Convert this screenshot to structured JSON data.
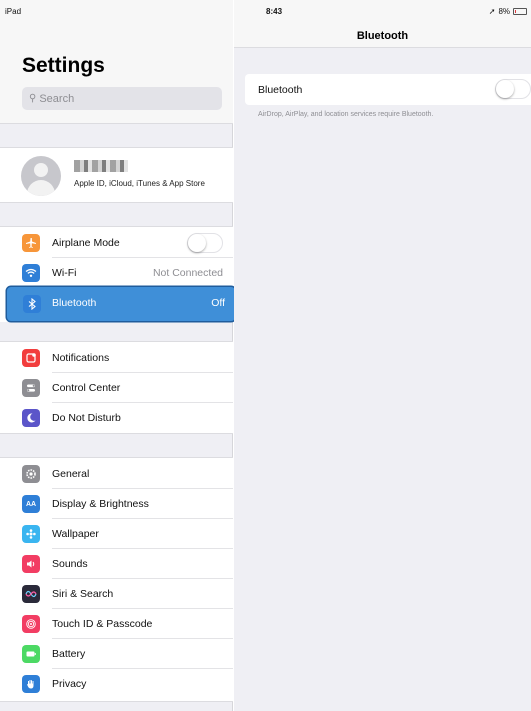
{
  "status_bar": {
    "carrier": "iPad",
    "time": "8:43",
    "location_glyph": "➚",
    "battery_percent": "8%",
    "battery_level": 0.08,
    "battery_color": "#e0393e"
  },
  "sidebar": {
    "title": "Settings",
    "search_placeholder": "Search",
    "profile": {
      "subtitle": "Apple ID, iCloud, iTunes & App Store"
    },
    "groups": [
      {
        "items": [
          {
            "label": "Airplane Mode",
            "icon": "airplane-icon",
            "icon_color": "#f7963a",
            "toggle": false
          },
          {
            "label": "Wi-Fi",
            "icon": "wifi-icon",
            "icon_color": "#2f7fd7",
            "value": "Not Connected"
          },
          {
            "label": "Bluetooth",
            "icon": "bluetooth-icon",
            "icon_color": "#2f7fd7",
            "value": "Off",
            "selected": true
          }
        ]
      },
      {
        "items": [
          {
            "label": "Notifications",
            "icon": "notifications-icon",
            "icon_color": "#f23d3d"
          },
          {
            "label": "Control Center",
            "icon": "control-center-icon",
            "icon_color": "#8e8e93"
          },
          {
            "label": "Do Not Disturb",
            "icon": "moon-icon",
            "icon_color": "#5b55c9"
          }
        ]
      },
      {
        "items": [
          {
            "label": "General",
            "icon": "gear-icon",
            "icon_color": "#8e8e93"
          },
          {
            "label": "Display & Brightness",
            "icon": "display-icon",
            "icon_color": "#2f7fd7",
            "icon_text": "AA"
          },
          {
            "label": "Wallpaper",
            "icon": "wallpaper-icon",
            "icon_color": "#3ab5f0"
          },
          {
            "label": "Sounds",
            "icon": "speaker-icon",
            "icon_color": "#f23d63"
          },
          {
            "label": "Siri & Search",
            "icon": "siri-icon",
            "icon_color": "#2a2a3a"
          },
          {
            "label": "Touch ID & Passcode",
            "icon": "fingerprint-icon",
            "icon_color": "#f23d63"
          },
          {
            "label": "Battery",
            "icon": "battery-icon",
            "icon_color": "#4cd964"
          },
          {
            "label": "Privacy",
            "icon": "hand-icon",
            "icon_color": "#2f7fd7"
          }
        ]
      }
    ]
  },
  "detail": {
    "title": "Bluetooth",
    "bluetooth_label": "Bluetooth",
    "bluetooth_on": false,
    "note": "AirDrop, AirPlay, and location services require Bluetooth."
  }
}
